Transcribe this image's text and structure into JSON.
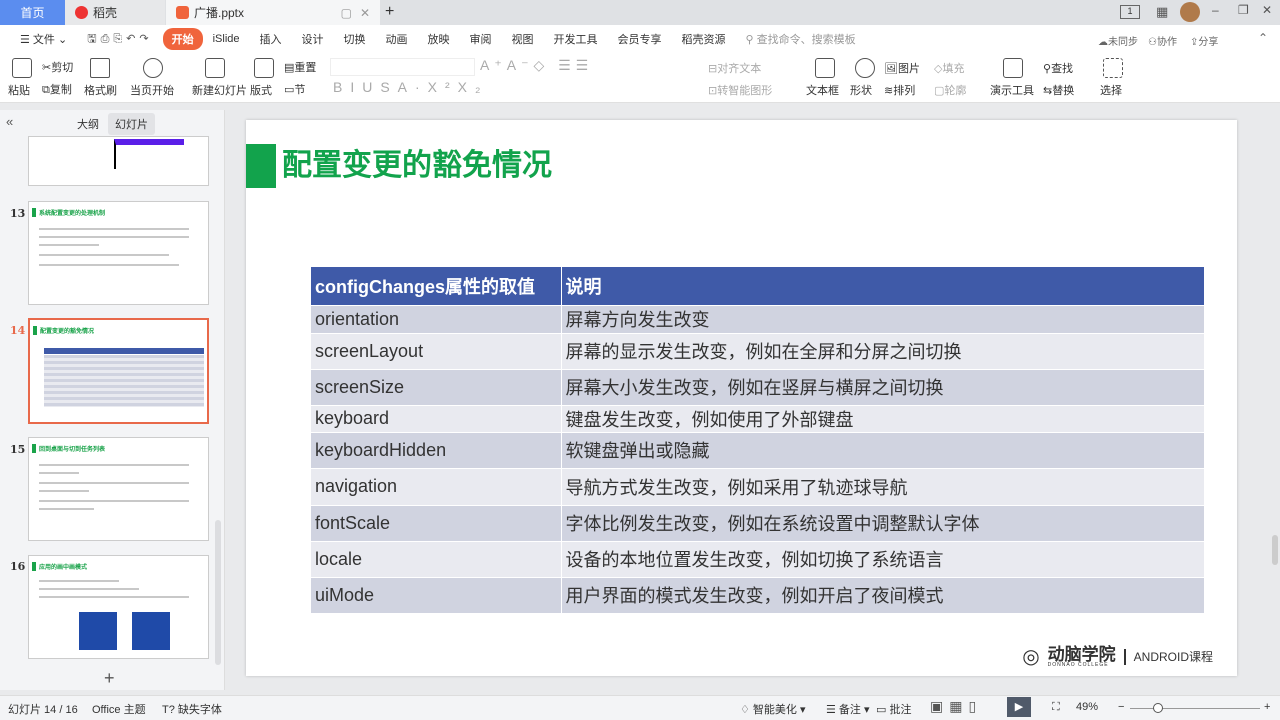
{
  "tabs": {
    "home": "首页",
    "daoke": "稻壳",
    "document": "广播.pptx"
  },
  "menu": {
    "file": "文件",
    "items": [
      "开始",
      "iSlide",
      "插入",
      "设计",
      "切换",
      "动画",
      "放映",
      "审阅",
      "视图",
      "开发工具",
      "会员专享",
      "稻壳资源"
    ],
    "search_placeholder": "查找命令、搜索模板",
    "sync": "未同步",
    "collab": "协作",
    "share": "分享"
  },
  "ribbon": {
    "paste": "粘贴",
    "cut": "剪切",
    "copy": "复制",
    "format_painter": "格式刷",
    "play_from_current": "当页开始",
    "new_slide": "新建幻灯片",
    "layout": "版式",
    "reset": "重置",
    "section": "节",
    "align_text": "对齐文本",
    "smart_shape": "转智能图形",
    "textbox": "文本框",
    "shape": "形状",
    "picture": "图片",
    "fill": "填充",
    "arrange": "排列",
    "outline": "轮廓",
    "presenter_tools": "演示工具",
    "find": "查找",
    "replace": "替换",
    "select": "选择"
  },
  "panel": {
    "outline_tab": "大纲",
    "slides_tab": "幻灯片",
    "add": "+"
  },
  "thumbnails": [
    {
      "num": "13",
      "title": "系统配置变更的处理机制"
    },
    {
      "num": "14",
      "title": "配置变更的豁免情况"
    },
    {
      "num": "15",
      "title": "回到桌面与切到任务列表"
    },
    {
      "num": "16",
      "title": "应用的画中画模式"
    }
  ],
  "slide": {
    "title": "配置变更的豁免情况",
    "headers": [
      "configChanges属性的取值",
      "说明"
    ],
    "rows": [
      [
        "orientation",
        "屏幕方向发生改变"
      ],
      [
        "screenLayout",
        "屏幕的显示发生改变，例如在全屏和分屏之间切换"
      ],
      [
        "screenSize",
        "屏幕大小发生改变，例如在竖屏与横屏之间切换"
      ],
      [
        "keyboard",
        "键盘发生改变，例如使用了外部键盘"
      ],
      [
        "keyboardHidden",
        "软键盘弹出或隐藏"
      ],
      [
        "navigation",
        "导航方式发生改变，例如采用了轨迹球导航"
      ],
      [
        "fontScale",
        "字体比例发生改变，例如在系统设置中调整默认字体"
      ],
      [
        "locale",
        "设备的本地位置发生改变，例如切换了系统语言"
      ],
      [
        "uiMode",
        "用户界面的模式发生改变，例如开启了夜间模式"
      ]
    ],
    "logo_name": "动脑学院",
    "logo_sub": "DONNAO COLLEGE",
    "course": "ANDROID课程"
  },
  "status": {
    "slide_pos": "幻灯片 14 / 16",
    "theme": "Office 主题",
    "missing_font": "缺失字体",
    "beautify": "智能美化",
    "notes": "备注",
    "comments": "批注",
    "zoom": "49%"
  }
}
